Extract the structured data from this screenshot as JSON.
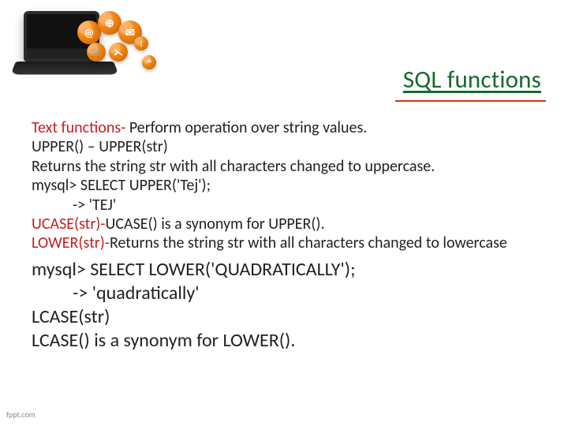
{
  "icons": {
    "at": "@",
    "globe": "⊕",
    "mail": "✉",
    "cart": "🛒",
    "rss": "⋋",
    "info": "i",
    "chat": "❝"
  },
  "title": " SQL functions",
  "body": {
    "textfn_heading": "Text functions- ",
    "textfn_desc": "Perform operation over string values.",
    "upper_sig": "UPPER() – UPPER(str)",
    "upper_desc": "Returns the string str with all characters changed to uppercase.",
    "upper_ex1": "mysql> SELECT UPPER('Tej');",
    "upper_ex2": "-> 'TEJ'",
    "ucase_line_a": "UCASE(str)-",
    "ucase_line_b": "UCASE() is a synonym for UPPER().",
    "lower_line_a": "LOWER(str)-",
    "lower_line_b": "Returns the string str with all characters changed to lowercase",
    "lower_ex1": "mysql> SELECT LOWER('QUADRATICALLY');",
    "lower_ex2": "-> 'quadratically'",
    "lcase_sig": "LCASE(str)",
    "lcase_desc": "LCASE() is a synonym for LOWER()."
  },
  "footer": "fppt.com"
}
